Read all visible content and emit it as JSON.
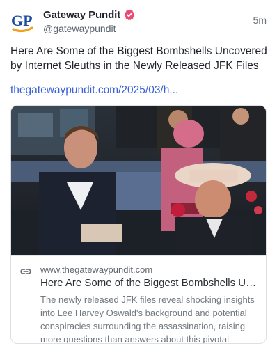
{
  "author": {
    "name": "Gateway Pundit",
    "handle": "@gatewaypundit",
    "avatar_text": "GP",
    "verified_icon": "verified-badge-icon"
  },
  "post": {
    "time": "5m",
    "text": "Here Are Some of the Biggest Bombshells Uncovered by Internet Sleuths in the Newly Released JFK Files",
    "link": "thegatewaypundit.com/2025/03/h..."
  },
  "card": {
    "image_description_icon": "photo",
    "icon": "link-icon",
    "domain": "www.thegatewaypundit.com",
    "title": "Here Are Some of the Biggest Bombshells Unc...",
    "description": "The newly released JFK files reveal shocking insights into Lee Harvey Oswald's background and potential conspiracies surrounding the assassination, raising more questions than answers about this pivotal mome..."
  },
  "colors": {
    "link": "#3a5fd9",
    "verified": "#ec4a75",
    "avatar_blue": "#1e4ba0",
    "avatar_orange": "#f0a01e"
  }
}
